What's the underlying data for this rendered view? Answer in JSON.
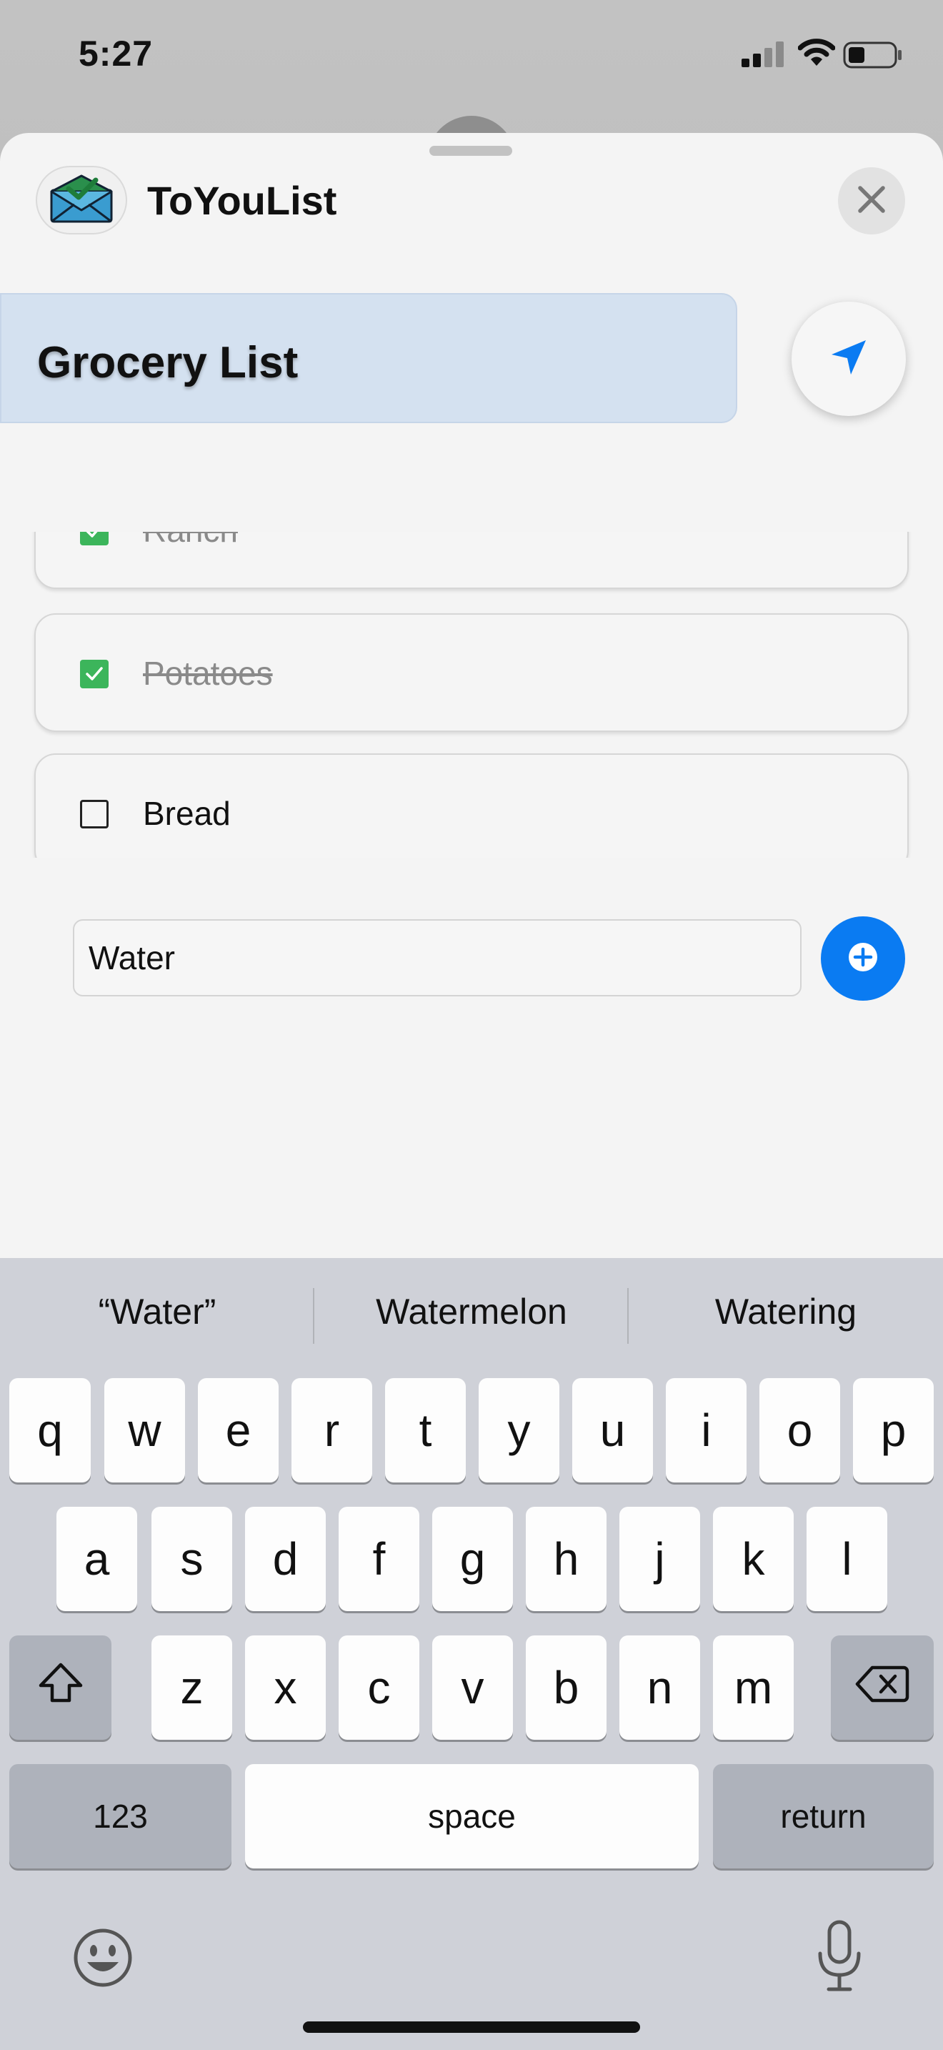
{
  "status_bar": {
    "time": "5:27",
    "icons": [
      "signal-icon",
      "wifi-icon",
      "battery-icon"
    ]
  },
  "sheet": {
    "app_name": "ToYouList",
    "app_logo_icon": "envelope-check-icon",
    "close_icon": "close-icon",
    "list_title": "Grocery List",
    "send_icon": "send-icon",
    "items": [
      {
        "label": "Ranch",
        "checked": true
      },
      {
        "label": "Potatoes",
        "checked": true
      },
      {
        "label": "Bread",
        "checked": false
      }
    ],
    "new_item_value": "Water",
    "add_icon": "plus-circle-icon"
  },
  "keyboard": {
    "suggestions": [
      "“Water”",
      "Watermelon",
      "Watering"
    ],
    "row1": [
      "q",
      "w",
      "e",
      "r",
      "t",
      "y",
      "u",
      "i",
      "o",
      "p"
    ],
    "row2": [
      "a",
      "s",
      "d",
      "f",
      "g",
      "h",
      "j",
      "k",
      "l"
    ],
    "row3": [
      "z",
      "x",
      "c",
      "v",
      "b",
      "n",
      "m"
    ],
    "numbers_label": "123",
    "space_label": "space",
    "return_label": "return",
    "icons": [
      "shift-icon",
      "delete-icon",
      "emoji-icon",
      "microphone-icon"
    ]
  },
  "colors": {
    "accent_blue": "#0a7bf2",
    "check_green": "#3cb55b",
    "title_card_bg": "#d4e1f0",
    "sheet_bg": "#f4f4f4",
    "keyboard_bg": "#cfd1d8"
  }
}
